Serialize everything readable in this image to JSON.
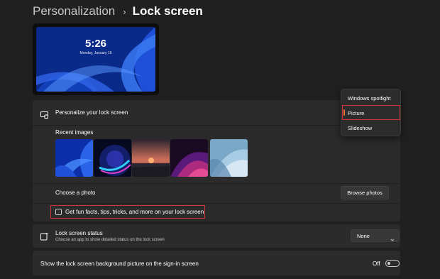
{
  "breadcrumb": {
    "parent": "Personalization",
    "separator": "›",
    "current": "Lock screen"
  },
  "preview": {
    "time": "5:26",
    "date": "Monday, January 19"
  },
  "personalize": {
    "label": "Personalize your lock screen",
    "recent_images_label": "Recent images",
    "recent_images": [
      "bloom-blue",
      "glow-orb",
      "sunset-lake",
      "purple-waves",
      "light-blue-bloom"
    ],
    "choose_photo_label": "Choose a photo",
    "browse_button": "Browse photos",
    "fun_facts_label": "Get fun facts, tips, tricks, and more on your lock screen",
    "fun_facts_checked": false
  },
  "dropdown_menu": {
    "items": [
      "Windows spotlight",
      "Picture",
      "Slideshow"
    ],
    "selected": "Picture"
  },
  "status": {
    "label": "Lock screen status",
    "sublabel": "Choose an app to show detailed status on the lock screen",
    "value": "None"
  },
  "signin": {
    "label": "Show the lock screen background picture on the sign-in screen",
    "toggle_label": "Off",
    "toggle_on": false
  },
  "colors": {
    "accent": "#e8743b",
    "highlight": "#d13438",
    "background": "#202020",
    "card": "#2b2b2b"
  }
}
